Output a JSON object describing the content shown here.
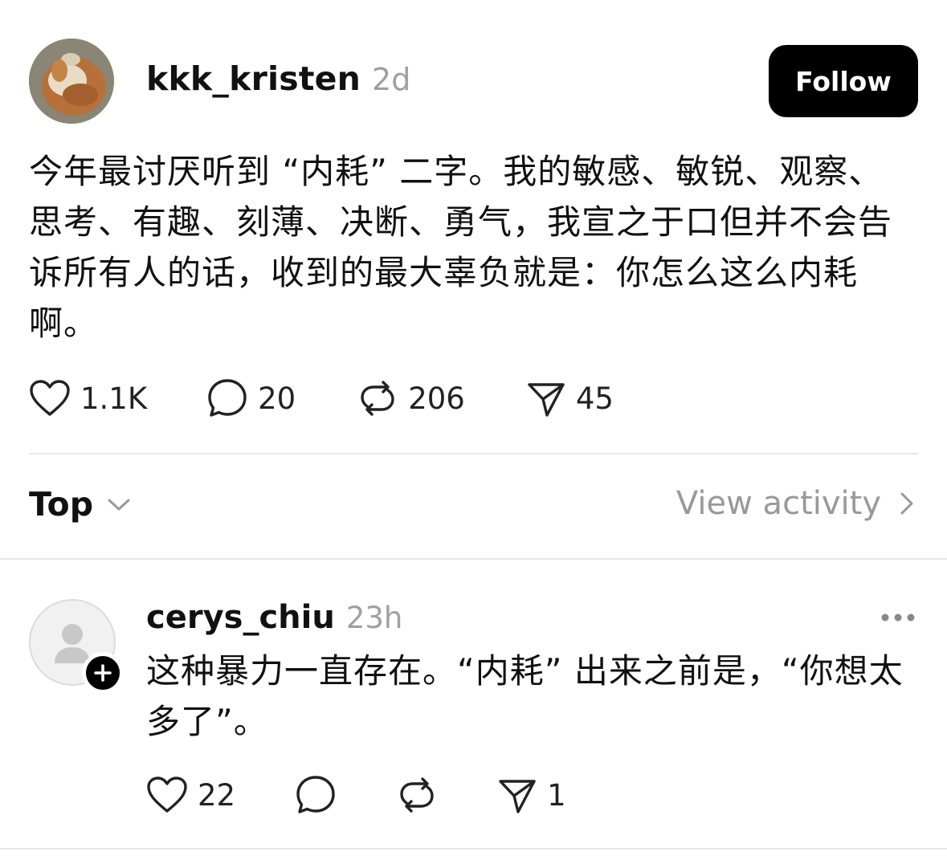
{
  "post": {
    "username": "kkk_kristen",
    "time": "2d",
    "follow_label": "Follow",
    "text": "今年最讨厌听到 “内耗” 二字。我的敏感、敏锐、观察、思考、有趣、刻薄、决断、勇气，我宣之于口但并不会告诉所有人的话，收到的最大辜负就是：你怎么这么内耗啊。",
    "actions": {
      "likes": "1.1K",
      "comments": "20",
      "reposts": "206",
      "shares": "45"
    }
  },
  "sort": {
    "label": "Top",
    "view_activity": "View activity"
  },
  "reply": {
    "username": "cerys_chiu",
    "time": "23h",
    "text": "这种暴力一直存在。“内耗” 出来之前是，“你想太多了”。",
    "actions": {
      "likes": "22",
      "comments": "",
      "reposts": "",
      "shares": "1"
    }
  },
  "icons": {
    "like": "heart-icon",
    "comment": "speech-bubble-icon",
    "repost": "repost-arrows-icon",
    "share": "paper-plane-icon",
    "sort": "chevron-down-icon",
    "activity": "chevron-right-icon",
    "more": "more-dots-icon",
    "follow_plus": "plus-icon"
  },
  "colors": {
    "text": "#111111",
    "muted": "#999999",
    "button_bg": "#000000",
    "button_text": "#ffffff",
    "divider": "#e6e6e6"
  }
}
